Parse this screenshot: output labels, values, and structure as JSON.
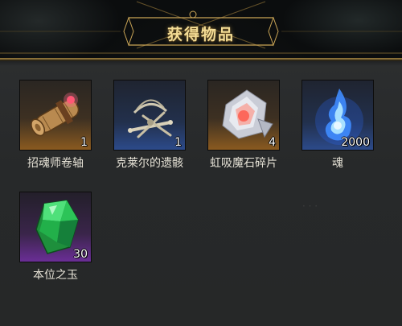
{
  "title": "获得物品",
  "items": [
    {
      "name": "招魂师卷轴",
      "count": "1",
      "rarity": "orange",
      "icon": "scroll-icon"
    },
    {
      "name": "克莱尔的遗骸",
      "count": "1",
      "rarity": "blue",
      "icon": "bones-icon"
    },
    {
      "name": "虹吸魔石碎片",
      "count": "4",
      "rarity": "orange",
      "icon": "crystal-shard-icon"
    },
    {
      "name": "魂",
      "count": "2000",
      "rarity": "blue",
      "icon": "soul-flame-icon"
    },
    {
      "name": "本位之玉",
      "count": "30",
      "rarity": "purple",
      "icon": "green-gem-icon"
    }
  ],
  "colors": {
    "title": "#f3dc95",
    "frame_gold": "#8a7038",
    "rarity_orange": "#8a5a20",
    "rarity_blue": "#2c4a8a",
    "rarity_purple": "#6a2e96"
  }
}
